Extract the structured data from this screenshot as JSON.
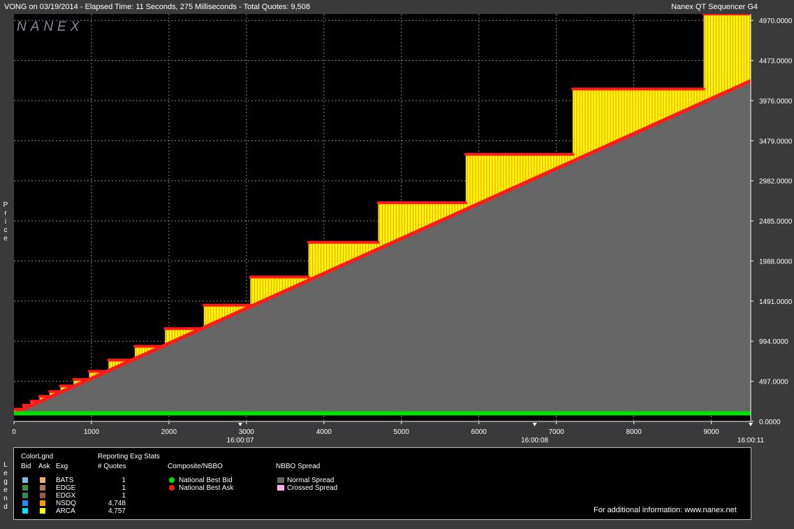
{
  "header": {
    "left": "VONG on 03/19/2014  -  Elapsed Time: 11 Seconds, 275 Milliseconds  -  Total Quotes: 9,508",
    "right": "Nanex QT Sequencer G4",
    "logo": "NANEX"
  },
  "colors": {
    "plot_bg": "#000000",
    "frame_bg": "#3a3a3a",
    "grid": "#8a8a8a",
    "bid": "#00e000",
    "ask": "#ff1a1a",
    "spread_normal": "#656565",
    "nsdq": "#ff9900",
    "arca": "#ffff00"
  },
  "chart_data": {
    "type": "area",
    "title": "VONG on 03/19/2014",
    "ylabel": "Price",
    "xlim": [
      0,
      9508
    ],
    "ylim": [
      0,
      5050
    ],
    "yticks": [
      0,
      497,
      994,
      1491,
      1988,
      2485,
      2982,
      3479,
      3976,
      4473,
      4970
    ],
    "ytick_labels": [
      "0.0000",
      "497.0000",
      "994.0000",
      "1491.0000",
      "1988.0000",
      "2485.0000",
      "2982.0000",
      "3479.0000",
      "3976.0000",
      "4473.0000",
      "4970.0000"
    ],
    "xticks": [
      0,
      1000,
      2000,
      3000,
      4000,
      5000,
      6000,
      7000,
      8000,
      9000
    ],
    "xtick_labels": [
      "0",
      "1000",
      "2000",
      "3000",
      "4000",
      "5000",
      "6000",
      "7000",
      "8000",
      "9000"
    ],
    "time_labels": [
      {
        "x": 2920,
        "label": "16:00:07"
      },
      {
        "x": 6720,
        "label": "16:00:08"
      },
      {
        "x": 9508,
        "label": "16:00:11"
      }
    ],
    "grid": true,
    "series": [
      {
        "name": "National Best Bid",
        "x": [
          0,
          9508
        ],
        "y": [
          100,
          100
        ]
      },
      {
        "name": "National Best Ask",
        "x": [
          0,
          9508
        ],
        "y": [
          100,
          4220
        ]
      },
      {
        "name": "Ask quote steps",
        "steps": [
          {
            "x0": 0,
            "x1": 120,
            "y": 150
          },
          {
            "x0": 120,
            "x1": 220,
            "y": 200
          },
          {
            "x0": 220,
            "x1": 330,
            "y": 250
          },
          {
            "x0": 330,
            "x1": 460,
            "y": 310
          },
          {
            "x0": 460,
            "x1": 600,
            "y": 370
          },
          {
            "x0": 600,
            "x1": 770,
            "y": 440
          },
          {
            "x0": 770,
            "x1": 970,
            "y": 520
          },
          {
            "x0": 970,
            "x1": 1220,
            "y": 620
          },
          {
            "x0": 1220,
            "x1": 1560,
            "y": 760
          },
          {
            "x0": 1560,
            "x1": 1950,
            "y": 930
          },
          {
            "x0": 1950,
            "x1": 2450,
            "y": 1150
          },
          {
            "x0": 2450,
            "x1": 3050,
            "y": 1440
          },
          {
            "x0": 3050,
            "x1": 3800,
            "y": 1790
          },
          {
            "x0": 3800,
            "x1": 4700,
            "y": 2220
          },
          {
            "x0": 4700,
            "x1": 5830,
            "y": 2710
          },
          {
            "x0": 5830,
            "x1": 7210,
            "y": 3310
          },
          {
            "x0": 7210,
            "x1": 8900,
            "y": 4120
          },
          {
            "x0": 8900,
            "x1": 9508,
            "y": 5050
          }
        ]
      }
    ]
  },
  "legend": {
    "side_label": "Legend",
    "color_legend_title": "ColorLgnd",
    "col_bid": "Bid",
    "col_ask": "Ask",
    "col_exg": "Exg",
    "stats_title": "Reporting Exg Stats",
    "stats_col": "# Quotes",
    "exchanges": [
      {
        "name": "BATS",
        "quotes": "1",
        "bid_color": "#7fb8e6",
        "ask_color": "#f2b06a"
      },
      {
        "name": "EDGE",
        "quotes": "1",
        "bid_color": "#3f8f3f",
        "ask_color": "#b07a4e"
      },
      {
        "name": "EDGX",
        "quotes": "1",
        "bid_color": "#2e8b57",
        "ask_color": "#a05a3a"
      },
      {
        "name": "NSDQ",
        "quotes": "4,748",
        "bid_color": "#1e90ff",
        "ask_color": "#ff9900"
      },
      {
        "name": "ARCA",
        "quotes": "4,757",
        "bid_color": "#00e5ff",
        "ask_color": "#ffff00"
      }
    ],
    "composite_title": "Composite/NBBO",
    "nbb": "National Best Bid",
    "nbo": "National Best Ask",
    "spread_title": "NBBO Spread",
    "normal_spread": "Normal Spread",
    "crossed_spread": "Crossed Spread",
    "normal_color": "#656565",
    "crossed_color": "#ffb0e8",
    "info": "For additional information: www.nanex.net"
  }
}
